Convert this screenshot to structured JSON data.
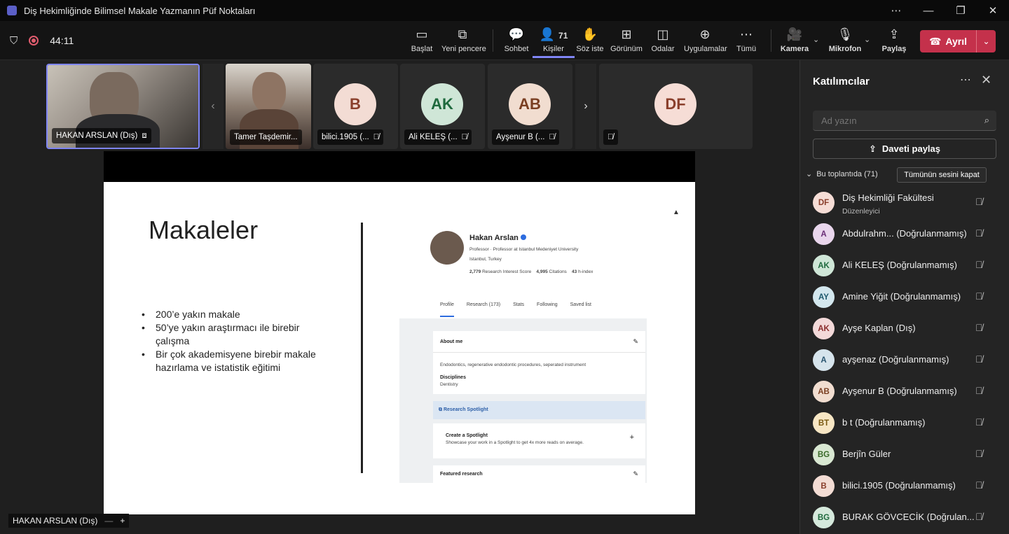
{
  "window": {
    "title": "Diş Hekimliğinde Bilimsel Makale Yazmanın Püf Noktaları"
  },
  "toolbar": {
    "timer": "44:11",
    "buttons": [
      {
        "label": "Başlat",
        "icon": "whiteboard-icon"
      },
      {
        "label": "Yeni pencere",
        "icon": "new-window-icon"
      },
      {
        "label": "Sohbet",
        "icon": "chat-icon"
      },
      {
        "label": "Kişiler",
        "icon": "people-icon",
        "count": "71"
      },
      {
        "label": "Söz iste",
        "icon": "raise-hand-icon"
      },
      {
        "label": "Görünüm",
        "icon": "view-icon"
      },
      {
        "label": "Odalar",
        "icon": "rooms-icon"
      },
      {
        "label": "Uygulamalar",
        "icon": "apps-icon"
      },
      {
        "label": "Tümü",
        "icon": "more-icon"
      },
      {
        "label": "Kamera",
        "icon": "camera-off-icon"
      },
      {
        "label": "Mikrofon",
        "icon": "mic-off-icon"
      },
      {
        "label": "Paylaş",
        "icon": "share-icon"
      }
    ],
    "leave_label": "Ayrıl"
  },
  "tiles": [
    {
      "name": "HAKAN ARSLAN (Dış)",
      "type": "video"
    },
    {
      "name": "Tamer Taşdemir...",
      "type": "video"
    },
    {
      "name": "bilici.1905 (...",
      "initials": "B",
      "color": "#f3dcd4"
    },
    {
      "name": "Ali KELEŞ (...",
      "initials": "AK",
      "color": "#cfe6d7"
    },
    {
      "name": "Ayşenur B (...",
      "initials": "AB",
      "color": "#f1ddd0"
    },
    {
      "name": "",
      "initials": "DF",
      "color": "#f6ddd6"
    }
  ],
  "slide": {
    "title": "Makaleler",
    "bullets": [
      "200’e yakın makale",
      "50’ye yakın araştırmacı ile birebir çalışma",
      "Bir çok akademisyene birebir makale hazırlama ve istatistik eğitimi"
    ],
    "profile": {
      "name": "Hakan Arslan",
      "line1": "Professor · Professor at Istanbul Medeniyet University",
      "line2": "Istanbul, Turkey",
      "score": "2,779",
      "score_label": "Research Interest Score",
      "citations": "4,995",
      "citations_label": "Citations",
      "hindex": "43",
      "hindex_label": "h-index",
      "tabs": [
        "Profile",
        "Research (173)",
        "Stats",
        "Following",
        "Saved list"
      ],
      "about_title": "About me",
      "about_text": "Endodontics, regenerative endodontic procedures, seperated instrument",
      "disc_title": "Disciplines",
      "disc_value": "Dentistry",
      "spotlight": "Research Spotlight",
      "create_spotlight": "Create a Spotlight",
      "spotlight_desc": "Showcase your work in a Spotlight to get 4x more reads on average.",
      "featured": "Featured research"
    }
  },
  "presenter_chip": "HAKAN ARSLAN (Dış)",
  "participants_panel": {
    "title": "Katılımcılar",
    "search_placeholder": "Ad yazın",
    "invite_label": "Daveti paylaş",
    "section_label": "Bu toplantıda (71)",
    "mute_all_label": "Tümünün sesini kapat",
    "people": [
      {
        "initials": "DF",
        "name": "Diş Hekimliği Fakültesi",
        "sub": "Düzenleyici",
        "color": "#f6ddd6"
      },
      {
        "initials": "A",
        "name": "Abdulrahm... (Doğrulanmamış)",
        "sub": "",
        "color": "#e9d6ec"
      },
      {
        "initials": "AK",
        "name": "Ali KELEŞ (Doğrulanmamış)",
        "sub": "",
        "color": "#cfe6d7"
      },
      {
        "initials": "AY",
        "name": "Amine Yiğit (Doğrulanmamış)",
        "sub": "",
        "color": "#d3e7ee"
      },
      {
        "initials": "AK",
        "name": "Ayşe Kaplan (Dış)",
        "sub": "",
        "color": "#f3d9d9"
      },
      {
        "initials": "A",
        "name": "ayşenaz (Doğrulanmamış)",
        "sub": "",
        "color": "#d6e4ec"
      },
      {
        "initials": "AB",
        "name": "Ayşenur B (Doğrulanmamış)",
        "sub": "",
        "color": "#f1ddd0"
      },
      {
        "initials": "BT",
        "name": "b t (Doğrulanmamış)",
        "sub": "",
        "color": "#f7e6c4"
      },
      {
        "initials": "BG",
        "name": "Berjîn Güler",
        "sub": "",
        "color": "#d9e8d2"
      },
      {
        "initials": "B",
        "name": "bilici.1905 (Doğrulanmamış)",
        "sub": "",
        "color": "#f3dcd4"
      },
      {
        "initials": "BG",
        "name": "BURAK GÖVCECİK (Doğrulan...",
        "sub": "",
        "color": "#d5e9dc"
      }
    ]
  }
}
